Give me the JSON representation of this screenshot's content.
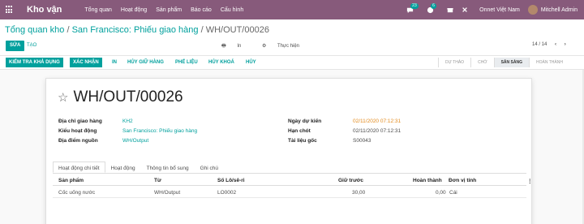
{
  "topbar": {
    "app_name": "Kho vận",
    "menu": [
      "Tổng quan",
      "Hoạt động",
      "Sản phẩm",
      "Báo cáo",
      "Cấu hình"
    ],
    "chat_count": "23",
    "activity_count": "6",
    "company": "Onnet Việt Nam",
    "user": "Mitchell Admin"
  },
  "breadcrumb": {
    "item1": "Tổng quan kho",
    "sep": "/",
    "item2": "San Francisco: Phiếu giao hàng",
    "current": "WH/OUT/00026"
  },
  "buttons": {
    "edit": "SỬA",
    "create": "TẠO",
    "print": "In",
    "action": "Thực hiện"
  },
  "pager": {
    "value": "14 / 14"
  },
  "statusbar": {
    "check": "KIỂM TRA KHẢ DỤNG",
    "validate": "XÁC NHẬN",
    "in": "IN",
    "unreserve": "HỦY GIỮ HÀNG",
    "scrap": "PHẾ LIỆU",
    "lock": "HỦY KHOÁ",
    "cancel": "HỦY",
    "stages": [
      "DỰ THẢO",
      "CHỜ",
      "SẴN SÀNG",
      "HOÀN THÀNH"
    ],
    "active_stage": "SẴN SÀNG"
  },
  "form": {
    "title": "WH/OUT/00026",
    "fields_left": [
      {
        "label": "Địa chỉ giao hàng",
        "value": "KH2"
      },
      {
        "label": "Kiểu hoạt động",
        "value": "San Francisco: Phiếu giao hàng"
      },
      {
        "label": "Địa điểm nguồn",
        "value": "WH/Output"
      }
    ],
    "fields_right": [
      {
        "label": "Ngày dự kiến",
        "value": "02/11/2020 07:12:31"
      },
      {
        "label": "Hạn chót",
        "value": "02/11/2020 07:12:31"
      },
      {
        "label": "Tài liệu gốc",
        "value": "S00043"
      }
    ],
    "tabs": [
      "Hoạt động chi tiết",
      "Hoạt động",
      "Thông tin bổ sung",
      "Ghi chú"
    ],
    "columns": [
      "Sản phẩm",
      "Từ",
      "Số Lô/sê-ri",
      "Giữ trước",
      "Hoàn thành",
      "Đơn vị tính"
    ],
    "rows": [
      {
        "product": "Cốc uống nước",
        "from": "WH/Output",
        "lot": "LO0002",
        "reserved": "30,00",
        "done": "0,00",
        "uom": "Cái"
      }
    ]
  },
  "colors": {
    "brand": "#875a7b",
    "accent": "#00a09d",
    "warning": "#e38a1c"
  }
}
